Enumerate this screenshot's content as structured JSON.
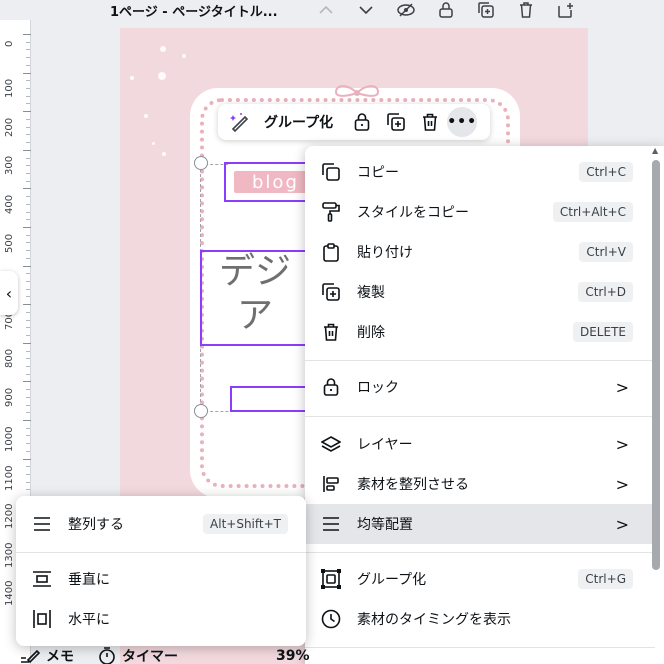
{
  "page_header": {
    "title": "1ページ - ページタイトル..."
  },
  "ruler": {
    "labels": [
      "0",
      "100",
      "200",
      "300",
      "400",
      "500",
      "600",
      "700",
      "800",
      "900",
      "1000",
      "1100",
      "1200",
      "1300",
      "1400"
    ]
  },
  "canvas": {
    "blog_text": "blog",
    "big_text_line1": "デジ",
    "big_text_line2": "ア"
  },
  "element_toolbar": {
    "group_label": "グループ化",
    "more_label": "•••"
  },
  "context_menu": {
    "items": [
      {
        "label": "コピー",
        "shortcut": "Ctrl+C",
        "icon": "copy-icon"
      },
      {
        "label": "スタイルをコピー",
        "shortcut": "Ctrl+Alt+C",
        "icon": "paint-roller-icon"
      },
      {
        "label": "貼り付け",
        "shortcut": "Ctrl+V",
        "icon": "clipboard-icon"
      },
      {
        "label": "複製",
        "shortcut": "Ctrl+D",
        "icon": "duplicate-icon"
      },
      {
        "label": "削除",
        "shortcut": "DELETE",
        "icon": "trash-icon"
      },
      {
        "label": "ロック",
        "chevron": ">",
        "icon": "lock-icon"
      },
      {
        "label": "レイヤー",
        "chevron": ">",
        "icon": "layers-icon"
      },
      {
        "label": "素材を整列させる",
        "chevron": ">",
        "icon": "align-left-icon"
      },
      {
        "label": "均等配置",
        "chevron": ">",
        "icon": "distribute-icon",
        "active": true
      },
      {
        "label": "グループ化",
        "shortcut": "Ctrl+G",
        "icon": "group-icon"
      },
      {
        "label": "素材のタイミングを表示",
        "icon": "clock-icon"
      }
    ]
  },
  "sub_menu": {
    "items": [
      {
        "label": "整列する",
        "shortcut": "Alt+Shift+T",
        "icon": "tidy-icon"
      },
      {
        "label": "垂直に",
        "icon": "distribute-vertical-icon"
      },
      {
        "label": "水平に",
        "icon": "distribute-horizontal-icon"
      }
    ]
  },
  "bottom_bar": {
    "memo": "メモ",
    "timer": "タイマー",
    "zoom": "39%"
  },
  "colors": {
    "accent": "#8b3dff",
    "canvas_bg": "#f2d9de",
    "ribbon": "#f0b8c3"
  }
}
